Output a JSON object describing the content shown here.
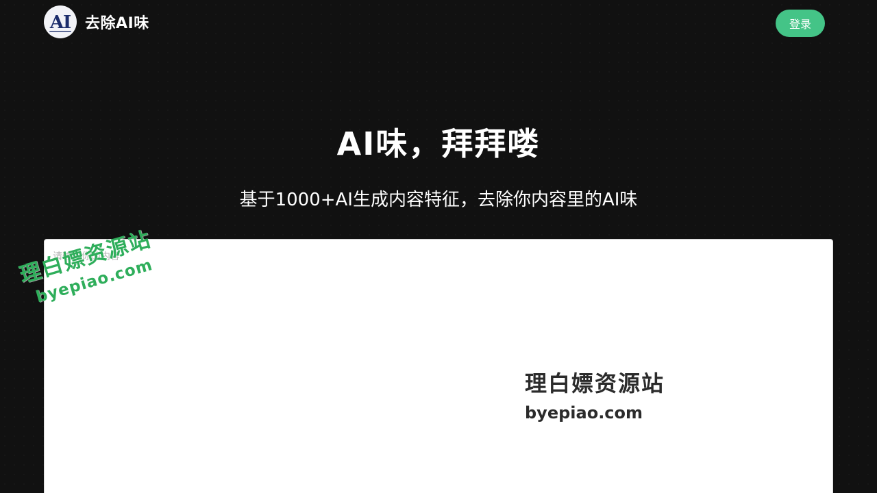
{
  "header": {
    "logo_text": "AI",
    "brand_name": "去除AI味",
    "login_label": "登录"
  },
  "hero": {
    "title": "AI味，拜拜喽",
    "subtitle": "基于1000+AI生成内容特征，去除你内容里的AI味"
  },
  "editor": {
    "value": "",
    "placeholder": "请输入你的内容"
  },
  "watermarks": [
    {
      "line1": "理白嫖资源站",
      "line2": "byepiao.com",
      "color": "#2fae5b"
    },
    {
      "line1": "理白嫖资源站",
      "line2": "byepiao.com",
      "color": "#2b2b2b"
    }
  ],
  "colors": {
    "background": "#111111",
    "accent": "#44c487",
    "text": "#ffffff"
  }
}
